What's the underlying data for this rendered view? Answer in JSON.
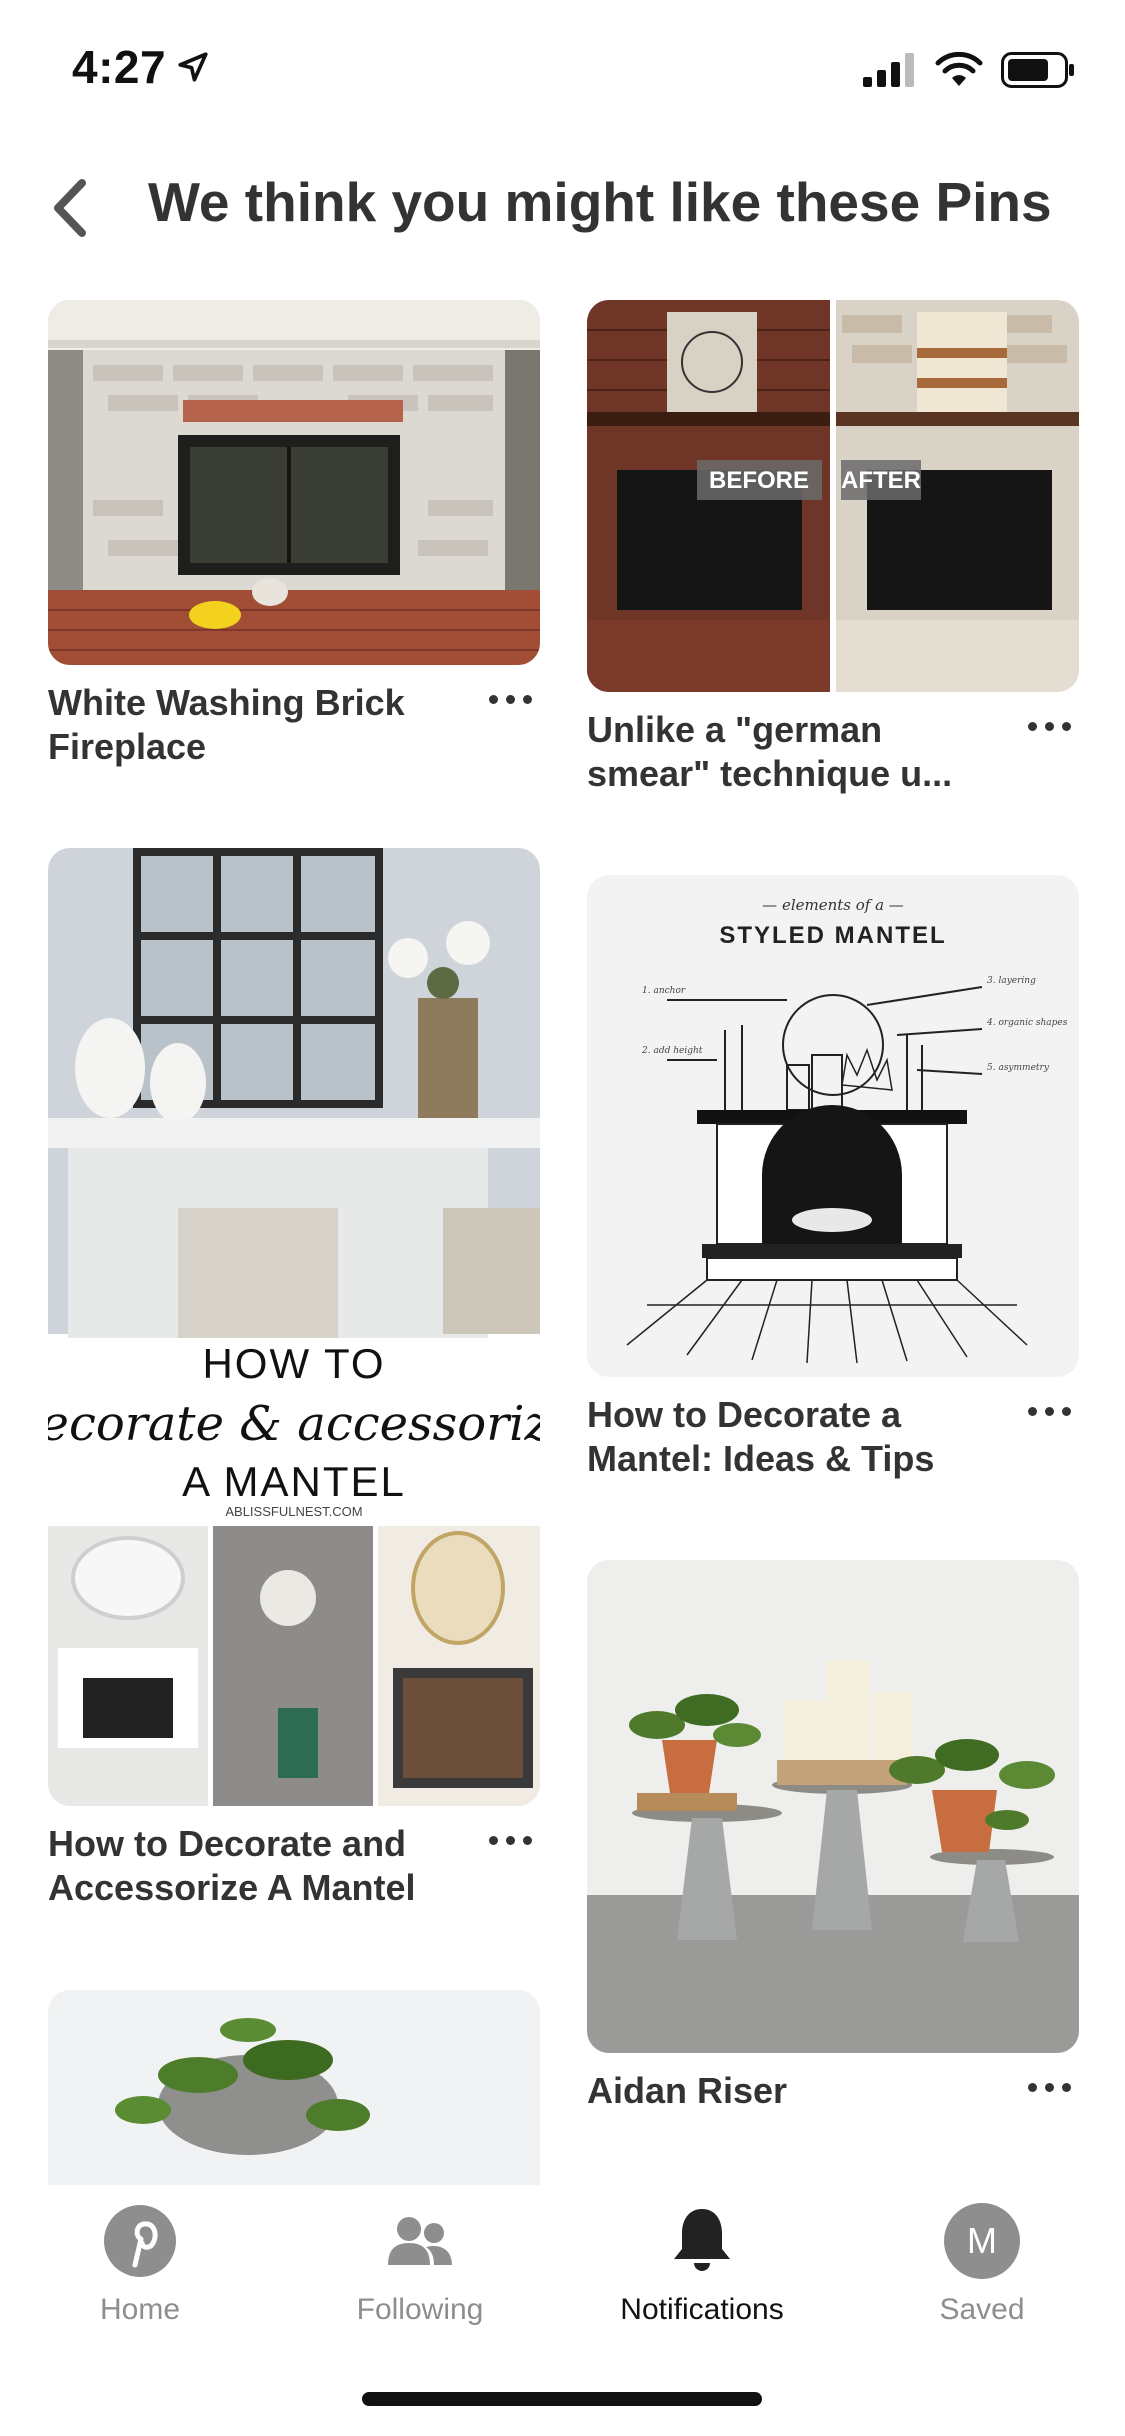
{
  "status_bar": {
    "time": "4:27",
    "icons": [
      "location-arrow-icon",
      "signal-icon",
      "wifi-icon",
      "battery-icon"
    ]
  },
  "header": {
    "back_icon": "chevron-left-icon",
    "title": "We think you might like these Pins"
  },
  "pins": [
    {
      "title": "White Washing Brick Fireplace",
      "image": "whitewashed brick fireplace"
    },
    {
      "title": "Unlike a \"german smear\" technique u...",
      "image": "fireplace before and after",
      "overlay_labels": [
        "BEFORE",
        "AFTER"
      ]
    },
    {
      "title": "How to Decorate and Accessorize A Mantel",
      "image": "decorated mantel collage",
      "overlay_text": {
        "line1": "HOW TO",
        "line2": "decorate & accessorize",
        "line3": "A MANTEL",
        "site": "ABLISSFULNEST.COM"
      }
    },
    {
      "title": "How to Decorate a Mantel: Ideas & Tips",
      "image": "styled mantel diagram",
      "overlay_text": {
        "kicker": "— elements of a —",
        "heading": "STYLED MANTEL",
        "callouts": [
          "1. anchor",
          "2. add height",
          "3. layering",
          "4. organic shapes",
          "5. asymmetry"
        ]
      }
    },
    {
      "title": "Aidan Riser",
      "image": "galvanized metal risers with plants and candles"
    },
    {
      "title": "",
      "image": "potted plant"
    }
  ],
  "tab_bar": {
    "tabs": [
      {
        "label": "Home",
        "icon": "pinterest-logo-icon",
        "active": false
      },
      {
        "label": "Following",
        "icon": "people-icon",
        "active": false
      },
      {
        "label": "Notifications",
        "icon": "bell-icon",
        "active": true
      },
      {
        "label": "Saved",
        "icon": "avatar-icon",
        "avatar_letter": "M",
        "active": false
      }
    ]
  },
  "colors": {
    "text": "#333333",
    "inactive_tab": "#8e8e8e",
    "active_tab": "#111111"
  }
}
